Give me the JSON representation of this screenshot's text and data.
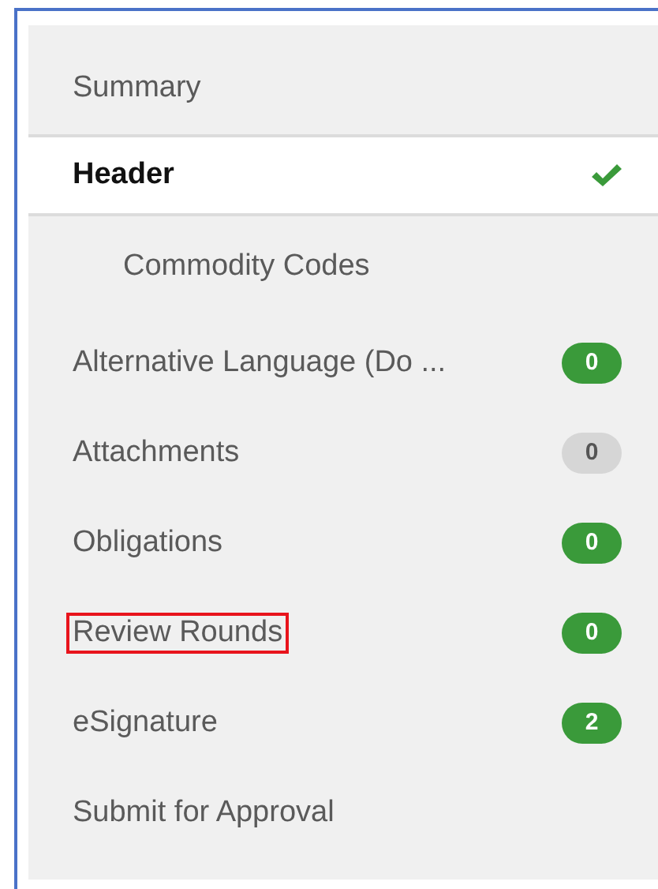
{
  "sidebar": {
    "items": [
      {
        "label": "Summary",
        "selected": false,
        "checked": false,
        "highlighted": false
      },
      {
        "label": "Header",
        "selected": true,
        "checked": true,
        "highlighted": false,
        "children": [
          {
            "label": "Commodity Codes",
            "selected": false,
            "checked": false,
            "highlighted": false
          }
        ]
      },
      {
        "label": "Alternative Language (Do ...",
        "selected": false,
        "checked": false,
        "highlighted": false,
        "badge": {
          "text": "0",
          "color": "#3a9a3a"
        }
      },
      {
        "label": "Attachments",
        "selected": false,
        "checked": false,
        "highlighted": false,
        "badge": {
          "text": "0",
          "color": "#d6d6d6"
        }
      },
      {
        "label": "Obligations",
        "selected": false,
        "checked": false,
        "highlighted": false,
        "badge": {
          "text": "0",
          "color": "#3a9a3a"
        }
      },
      {
        "label": "Review Rounds",
        "selected": false,
        "checked": false,
        "highlighted": true,
        "badge": {
          "text": "0",
          "color": "#3a9a3a"
        }
      },
      {
        "label": "eSignature",
        "selected": false,
        "checked": false,
        "highlighted": false,
        "badge": {
          "text": "2",
          "color": "#3a9a3a"
        }
      },
      {
        "label": "Submit for Approval",
        "selected": false,
        "checked": false,
        "highlighted": false
      }
    ]
  }
}
